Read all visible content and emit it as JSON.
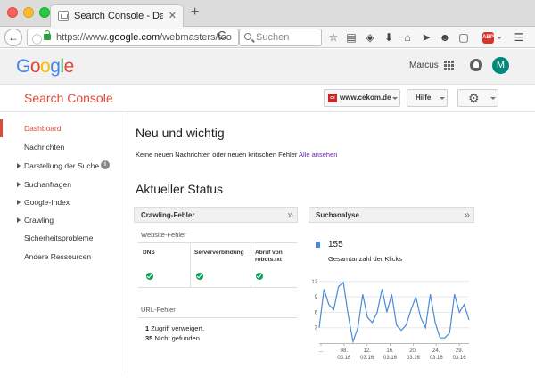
{
  "browser": {
    "tab_title": "Search Console - Dashboar...",
    "tab_close": "✕",
    "new_tab": "+",
    "url_prefix": "https://www.",
    "url_domain": "google.com",
    "url_rest": "/webmasters/too",
    "reload": "C",
    "search_placeholder": "Suchen",
    "toolbar_icons": [
      "bookmark-star-icon",
      "reading-list-icon",
      "shield-icon",
      "download-icon",
      "home-icon",
      "send-icon",
      "chat-icon",
      "pocket-icon",
      "adblock-icon",
      "menu-icon"
    ],
    "adblock_label": "ABP"
  },
  "google_header": {
    "logo_letters": [
      "G",
      "o",
      "o",
      "g",
      "l",
      "e"
    ],
    "user_name": "Marcus",
    "avatar_letter": "M",
    "avatar_color": "#00897b"
  },
  "app_header": {
    "title": "Search Console",
    "property": "www.cekom.de",
    "property_favicon": "ce",
    "help": "Hilfe",
    "settings_icon": "⚙"
  },
  "sidebar": {
    "items": [
      {
        "label": "Dashboard",
        "active": true,
        "expandable": false
      },
      {
        "label": "Nachrichten",
        "active": false,
        "expandable": false
      },
      {
        "label": "Darstellung der Suche",
        "active": false,
        "expandable": true,
        "info": "i"
      },
      {
        "label": "Suchanfragen",
        "active": false,
        "expandable": true
      },
      {
        "label": "Google-Index",
        "active": false,
        "expandable": true
      },
      {
        "label": "Crawling",
        "active": false,
        "expandable": true
      },
      {
        "label": "Sicherheitsprobleme",
        "active": false,
        "expandable": false
      },
      {
        "label": "Andere Ressourcen",
        "active": false,
        "expandable": false
      }
    ]
  },
  "main": {
    "news_heading": "Neu und wichtig",
    "news_message": "Keine neuen Nachrichten oder neuen kritischen Fehler",
    "news_link": "Alle ansehen",
    "status_heading": "Aktueller Status",
    "crawl_card": {
      "title": "Crawling-Fehler",
      "open_icon": "»",
      "site_errors_title": "Website-Fehler",
      "columns": [
        "DNS",
        "Serververbindung",
        "Abruf von robots.txt"
      ],
      "url_errors_title": "URL-Fehler",
      "url_errors": [
        {
          "count": "1",
          "label": "Zugriff verweigert."
        },
        {
          "count": "35",
          "label": "Nicht gefunden"
        }
      ]
    },
    "search_card": {
      "title": "Suchanalyse",
      "open_icon": "»",
      "total": "155",
      "metric_label": "Gesamtanzahl der Klicks",
      "series_color": "#4a8ad6"
    }
  },
  "chart_data": {
    "type": "line",
    "title": "",
    "xlabel": "",
    "ylabel": "",
    "y_ticks": [
      3,
      6,
      9,
      12
    ],
    "ylim": [
      0,
      13
    ],
    "x_tick_labels": [
      [
        "...",
        ""
      ],
      [
        "08.",
        "03.16"
      ],
      [
        "12.",
        "03.16"
      ],
      [
        "16.",
        "03.16"
      ],
      [
        "20.",
        "03.16"
      ],
      [
        "24.",
        "03.16"
      ],
      [
        "29.",
        "03.16"
      ]
    ],
    "series": [
      {
        "values": [
          3,
          10.5,
          7.5,
          6.5,
          11,
          11.8,
          5.5,
          0.3,
          3,
          9.5,
          5,
          4,
          6,
          10.5,
          6,
          9.5,
          3.5,
          2.5,
          3.5,
          6.5,
          9,
          5,
          3,
          9.5,
          4,
          1,
          1,
          2,
          9.5,
          6,
          7.5,
          4.5
        ]
      }
    ]
  }
}
